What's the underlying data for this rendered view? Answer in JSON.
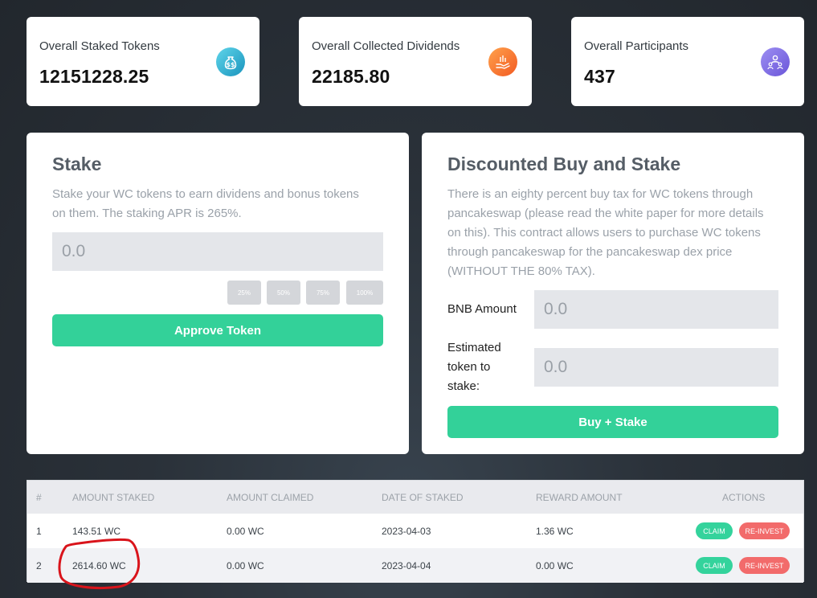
{
  "stats": [
    {
      "label": "Overall Staked Tokens",
      "value": "12151228.25",
      "icon": "money-bag-icon"
    },
    {
      "label": "Overall Collected Dividends",
      "value": "22185.80",
      "icon": "hand-coins-icon"
    },
    {
      "label": "Overall Participants",
      "value": "437",
      "icon": "participants-icon"
    }
  ],
  "stake": {
    "title": "Stake",
    "description": "Stake your WC tokens to earn dividens and bonus tokens on them. The staking APR is 265%.",
    "amount_placeholder": "0.0",
    "percent_buttons": [
      "25%",
      "50%",
      "75%",
      "100%"
    ],
    "approve_label": "Approve Token"
  },
  "buy": {
    "title": "Discounted Buy and Stake",
    "description": "There is an eighty percent buy tax for WC tokens through pancakeswap (please read the white paper for more details on this). This contract allows users to purchase WC tokens through pancakeswap for the pancakeswap dex price (WITHOUT THE 80% TAX).",
    "bnb_label": "BNB Amount",
    "bnb_placeholder": "0.0",
    "estimated_label": "Estimated token to stake:",
    "estimated_placeholder": "0.0",
    "button_label": "Buy + Stake"
  },
  "table": {
    "headers": [
      "#",
      "Amount Staked",
      "Amount Claimed",
      "Date of Staked",
      "Reward Amount",
      "Actions"
    ],
    "rows": [
      {
        "index": "1",
        "staked": "143.51 WC",
        "claimed": "0.00 WC",
        "date": "2023-04-03",
        "reward": "1.36 WC"
      },
      {
        "index": "2",
        "staked": "2614.60 WC",
        "claimed": "0.00 WC",
        "date": "2023-04-04",
        "reward": "0.00 WC"
      }
    ],
    "claim_label": "CLAIM",
    "reinvest_label": "RE-INVEST"
  },
  "colors": {
    "accent_green": "#33d199",
    "reinvest_red": "#f26b6b",
    "annotation_red": "#d9141b"
  }
}
